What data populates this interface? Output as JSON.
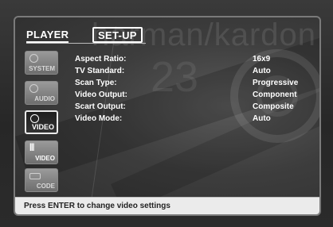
{
  "watermark": {
    "brand": "harman/kardon",
    "number": "23"
  },
  "tabs": [
    {
      "label": "PLAYER"
    },
    {
      "label": "SET-UP"
    }
  ],
  "sidebar": {
    "items": [
      {
        "label": "SYSTEM",
        "icon": "disc-icon"
      },
      {
        "label": "AUDIO",
        "icon": "disc-icon"
      },
      {
        "label": "VIDEO",
        "icon": "disc-icon",
        "active": true
      },
      {
        "label": "VIDEO",
        "icon": "equalizer-icon"
      },
      {
        "label": "CODE",
        "icon": "keypad-icon"
      }
    ]
  },
  "settings": [
    {
      "label": "Aspect Ratio:",
      "value": "16x9"
    },
    {
      "label": "TV Standard:",
      "value": "Auto"
    },
    {
      "label": "Scan Type:",
      "value": "Progressive"
    },
    {
      "label": "Video Output:",
      "value": "Component"
    },
    {
      "label": "Scart Output:",
      "value": "Composite"
    },
    {
      "label": "Video Mode:",
      "value": "Auto"
    }
  ],
  "status": {
    "text": "Press ENTER to change video settings"
  }
}
